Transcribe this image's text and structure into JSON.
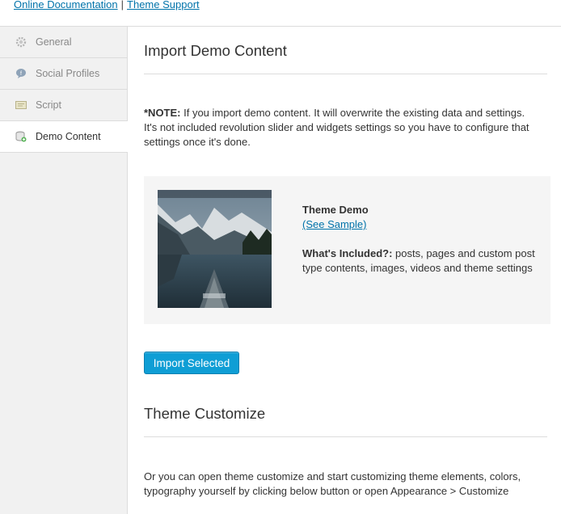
{
  "header": {
    "doc_link": "Online Documentation",
    "separator": "|",
    "support_link": "Theme Support"
  },
  "sidebar": {
    "items": [
      {
        "label": "General",
        "icon": "gear-icon"
      },
      {
        "label": "Social Profiles",
        "icon": "social-icon"
      },
      {
        "label": "Script",
        "icon": "script-icon"
      },
      {
        "label": "Demo Content",
        "icon": "database-icon",
        "active": true
      }
    ]
  },
  "main": {
    "import_title": "Import Demo Content",
    "note_label": "*NOTE:",
    "note_text": " If you import demo content. It will overwrite the existing data and settings. It's not included revolution slider and widgets settings so you have to configure that settings once it's done.",
    "demo": {
      "title": "Theme Demo",
      "sample_link": "(See Sample)",
      "included_label": "What's Included?:",
      "included_text": " posts, pages and custom post type contents, images, videos and theme settings"
    },
    "import_button": "Import Selected",
    "customize_title": "Theme Customize",
    "customize_text": "Or you can open theme customize and start customizing theme elements, colors, typography yourself by clicking below button or open Appearance > Customize"
  },
  "colors": {
    "accent": "#0073aa",
    "button": "#0f9ed5",
    "sidebar_bg": "#f1f1f1",
    "demo_box_bg": "#f5f5f5"
  }
}
